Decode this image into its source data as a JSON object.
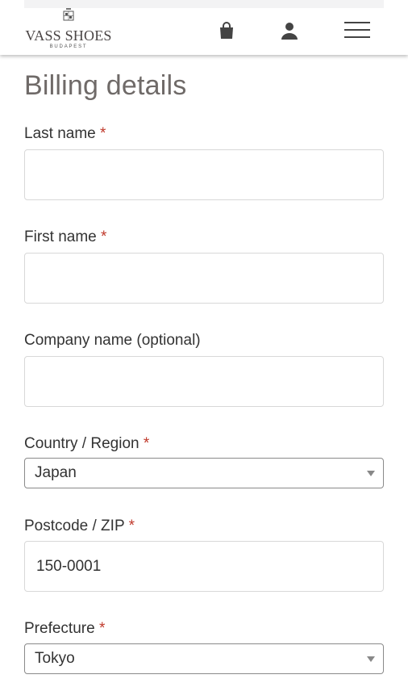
{
  "header": {
    "logo_top": "VASS",
    "logo_text": "VASS SHOES",
    "logo_sub": "BUDAPEST",
    "icons": [
      "shopping-bag-icon",
      "user-icon",
      "hamburger-menu-icon"
    ]
  },
  "form": {
    "title": "Billing details",
    "required_marker": "*",
    "fields": {
      "last_name": {
        "label": "Last name",
        "value": ""
      },
      "first_name": {
        "label": "First name",
        "value": ""
      },
      "company": {
        "label": "Company name (optional)",
        "value": ""
      },
      "country": {
        "label": "Country / Region",
        "value": "Japan"
      },
      "postcode": {
        "label": "Postcode / ZIP",
        "value": "150-0001"
      },
      "prefecture": {
        "label": "Prefecture",
        "value": "Tokyo"
      }
    }
  },
  "colors": {
    "required": "#c0392b",
    "title": "#6f6a68",
    "border": "#d8d8d8"
  }
}
